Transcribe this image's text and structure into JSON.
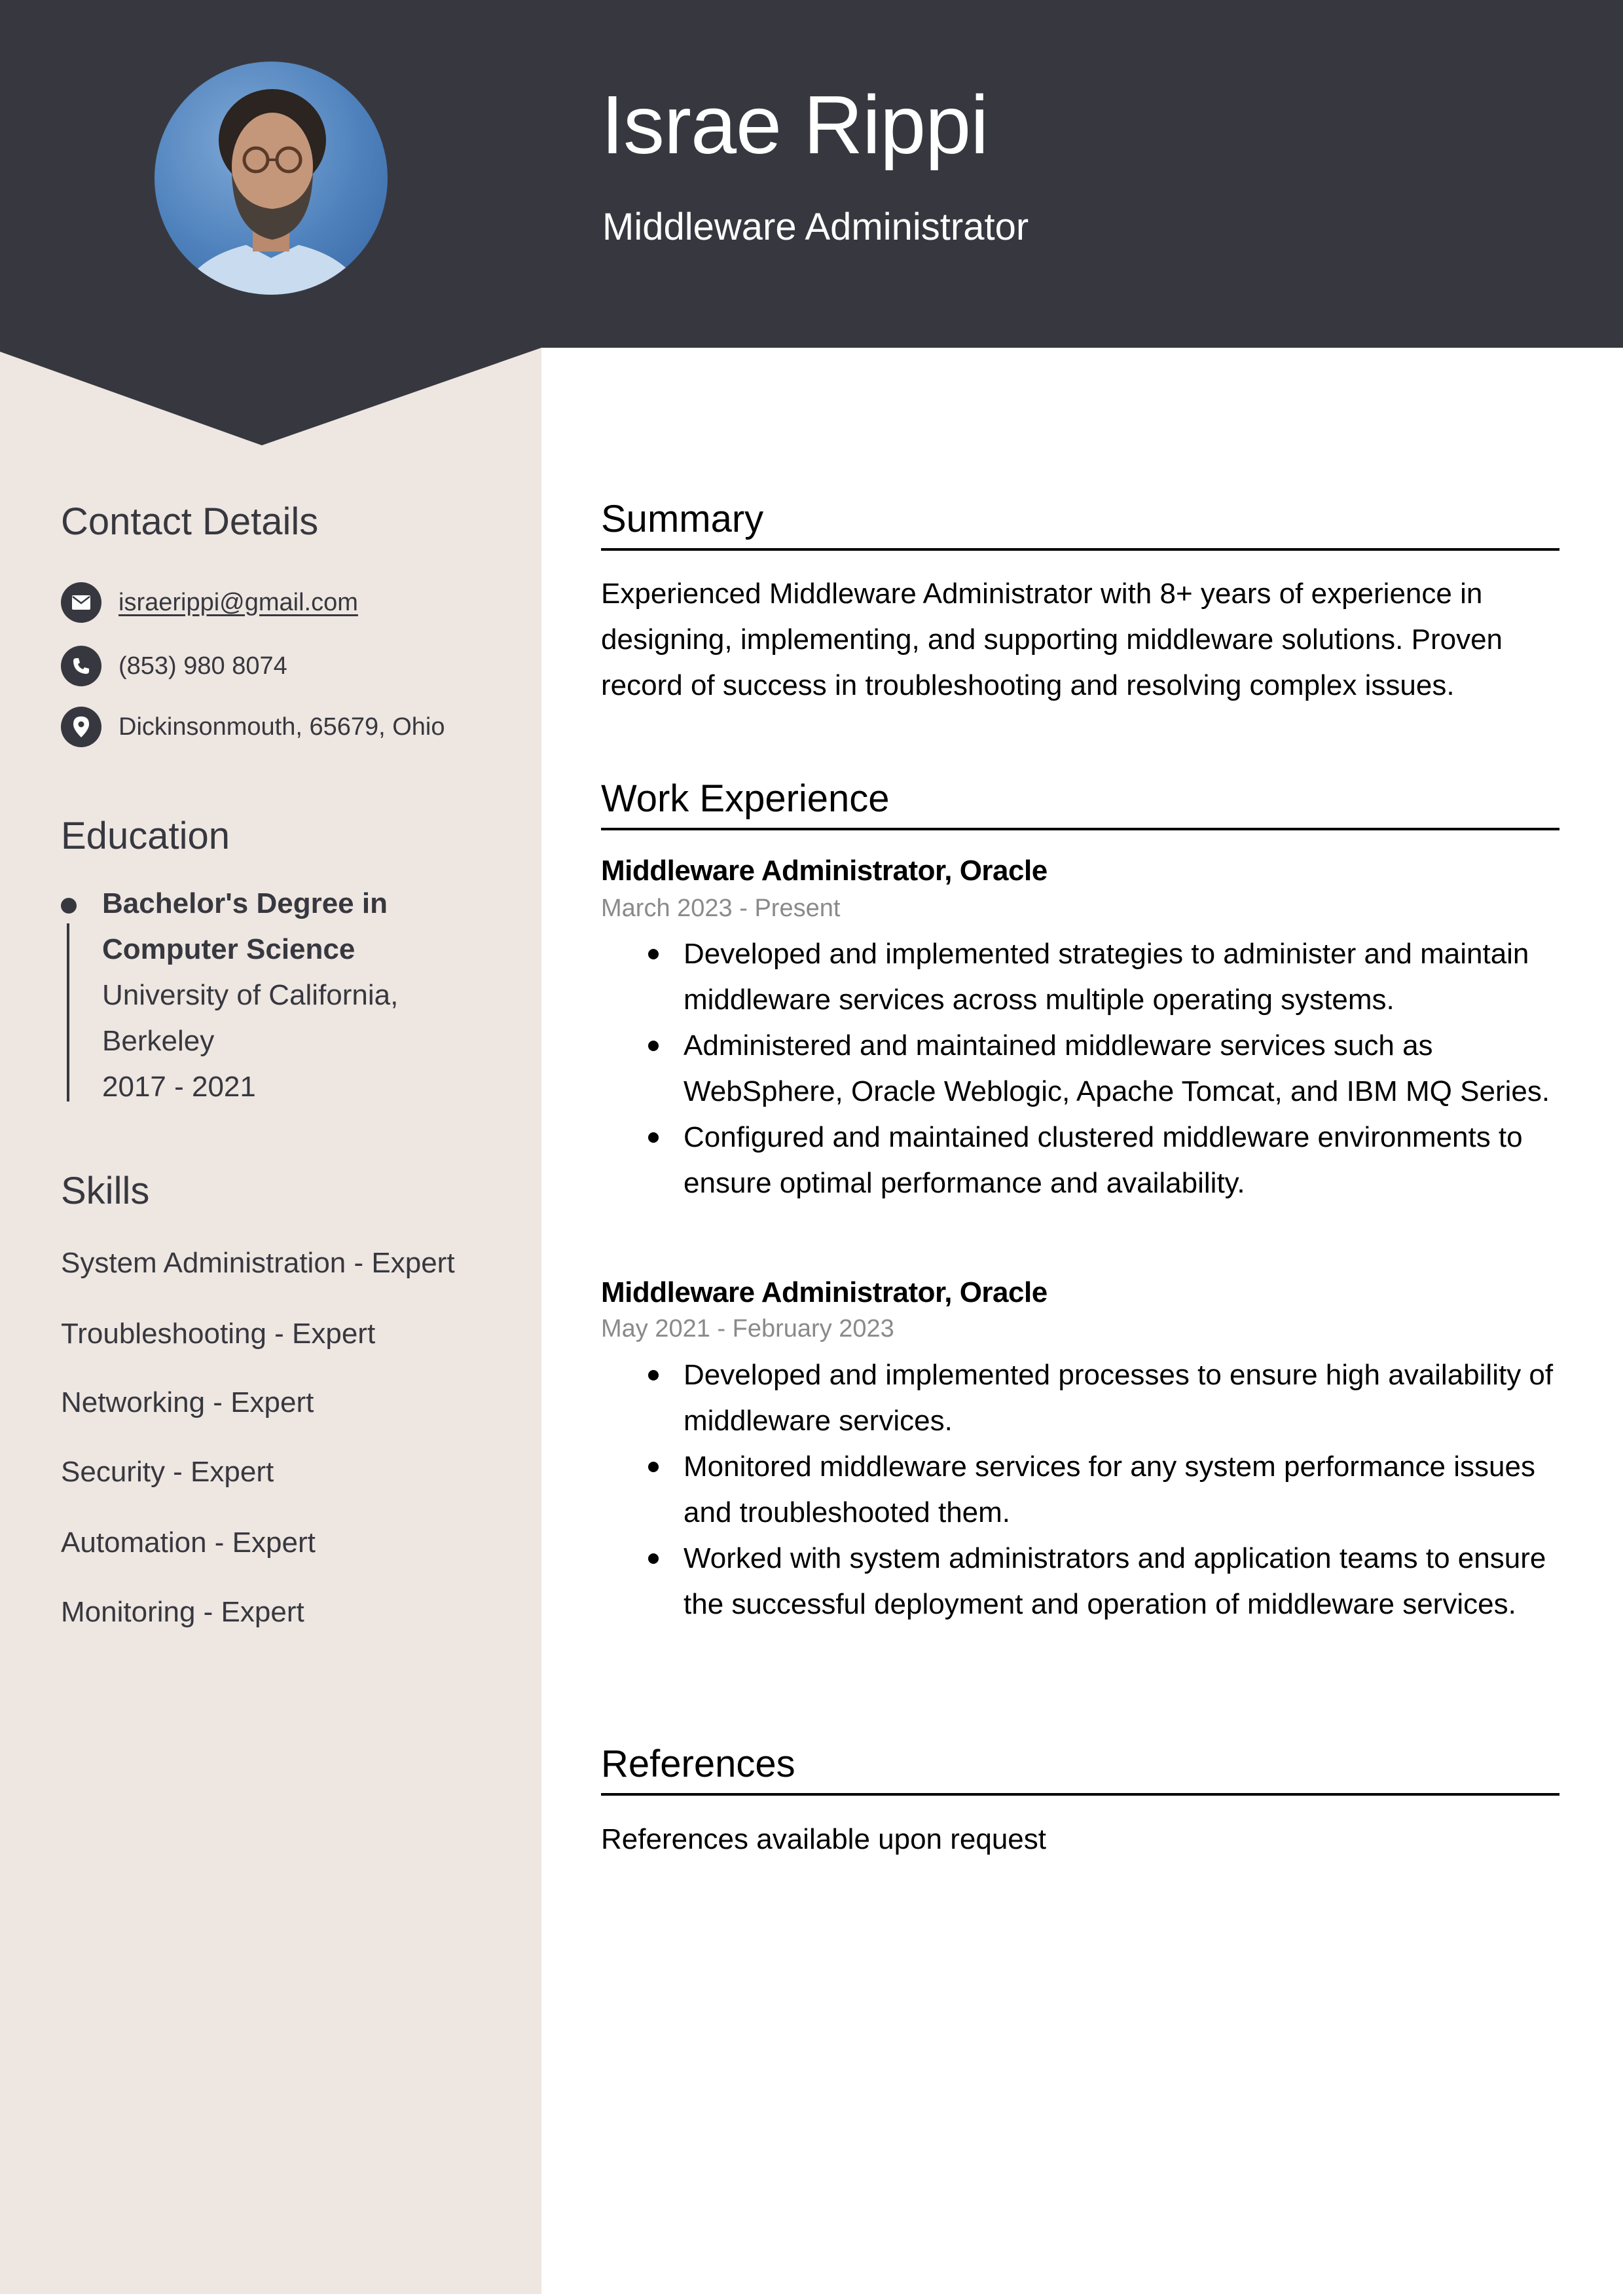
{
  "header": {
    "name": "Israe Rippi",
    "title": "Middleware Administrator",
    "photo_alt": "profile-photo"
  },
  "colors": {
    "header_bg": "#37383F",
    "sidebar_bg": "#EEE6E1",
    "text_dark": "#37383F",
    "date_gray": "#8A8A8A"
  },
  "sidebar": {
    "contact": {
      "heading": "Contact Details",
      "items": [
        {
          "icon": "envelope-icon",
          "text": "israerippi@gmail.com"
        },
        {
          "icon": "phone-icon",
          "text": "(853) 980 8074"
        },
        {
          "icon": "location-pin-icon",
          "text": "Dickinsonmouth, 65679, Ohio"
        }
      ]
    },
    "education": {
      "heading": "Education",
      "degree_line1": "Bachelor's Degree in",
      "degree_line2": "Computer Science",
      "school_line1": "University of California,",
      "school_line2": "Berkeley",
      "years": "2017 - 2021"
    },
    "skills": {
      "heading": "Skills",
      "items": [
        "System Administration - Expert",
        "Troubleshooting - Expert",
        "Networking - Expert",
        "Security - Expert",
        "Automation - Expert",
        "Monitoring - Expert"
      ]
    }
  },
  "main": {
    "summary": {
      "heading": "Summary",
      "lines": [
        "Experienced Middleware Administrator with 8+ years of experience in",
        "designing, implementing, and supporting middleware solutions. Proven",
        "record of success in troubleshooting and resolving complex issues."
      ]
    },
    "work": {
      "heading": "Work Experience",
      "jobs": [
        {
          "title": "Middleware Administrator, Oracle",
          "dates": "March 2023 - Present",
          "bullets": [
            "Developed and implemented strategies to administer and maintain middleware services across multiple operating systems.",
            "Administered and maintained middleware services such as WebSphere, Oracle Weblogic, Apache Tomcat, and IBM MQ Series.",
            "Configured and maintained clustered middleware environments to ensure optimal performance and availability."
          ]
        },
        {
          "title": "Middleware Administrator, Oracle",
          "dates": "May 2021 - February 2023",
          "bullets": [
            "Developed and implemented processes to ensure high availability of middleware services.",
            "Monitored middleware services for any system performance issues and troubleshooted them.",
            "Worked with system administrators and application teams to ensure the successful deployment and operation of middleware services."
          ]
        }
      ]
    },
    "references": {
      "heading": "References",
      "text": "References available upon request"
    }
  }
}
